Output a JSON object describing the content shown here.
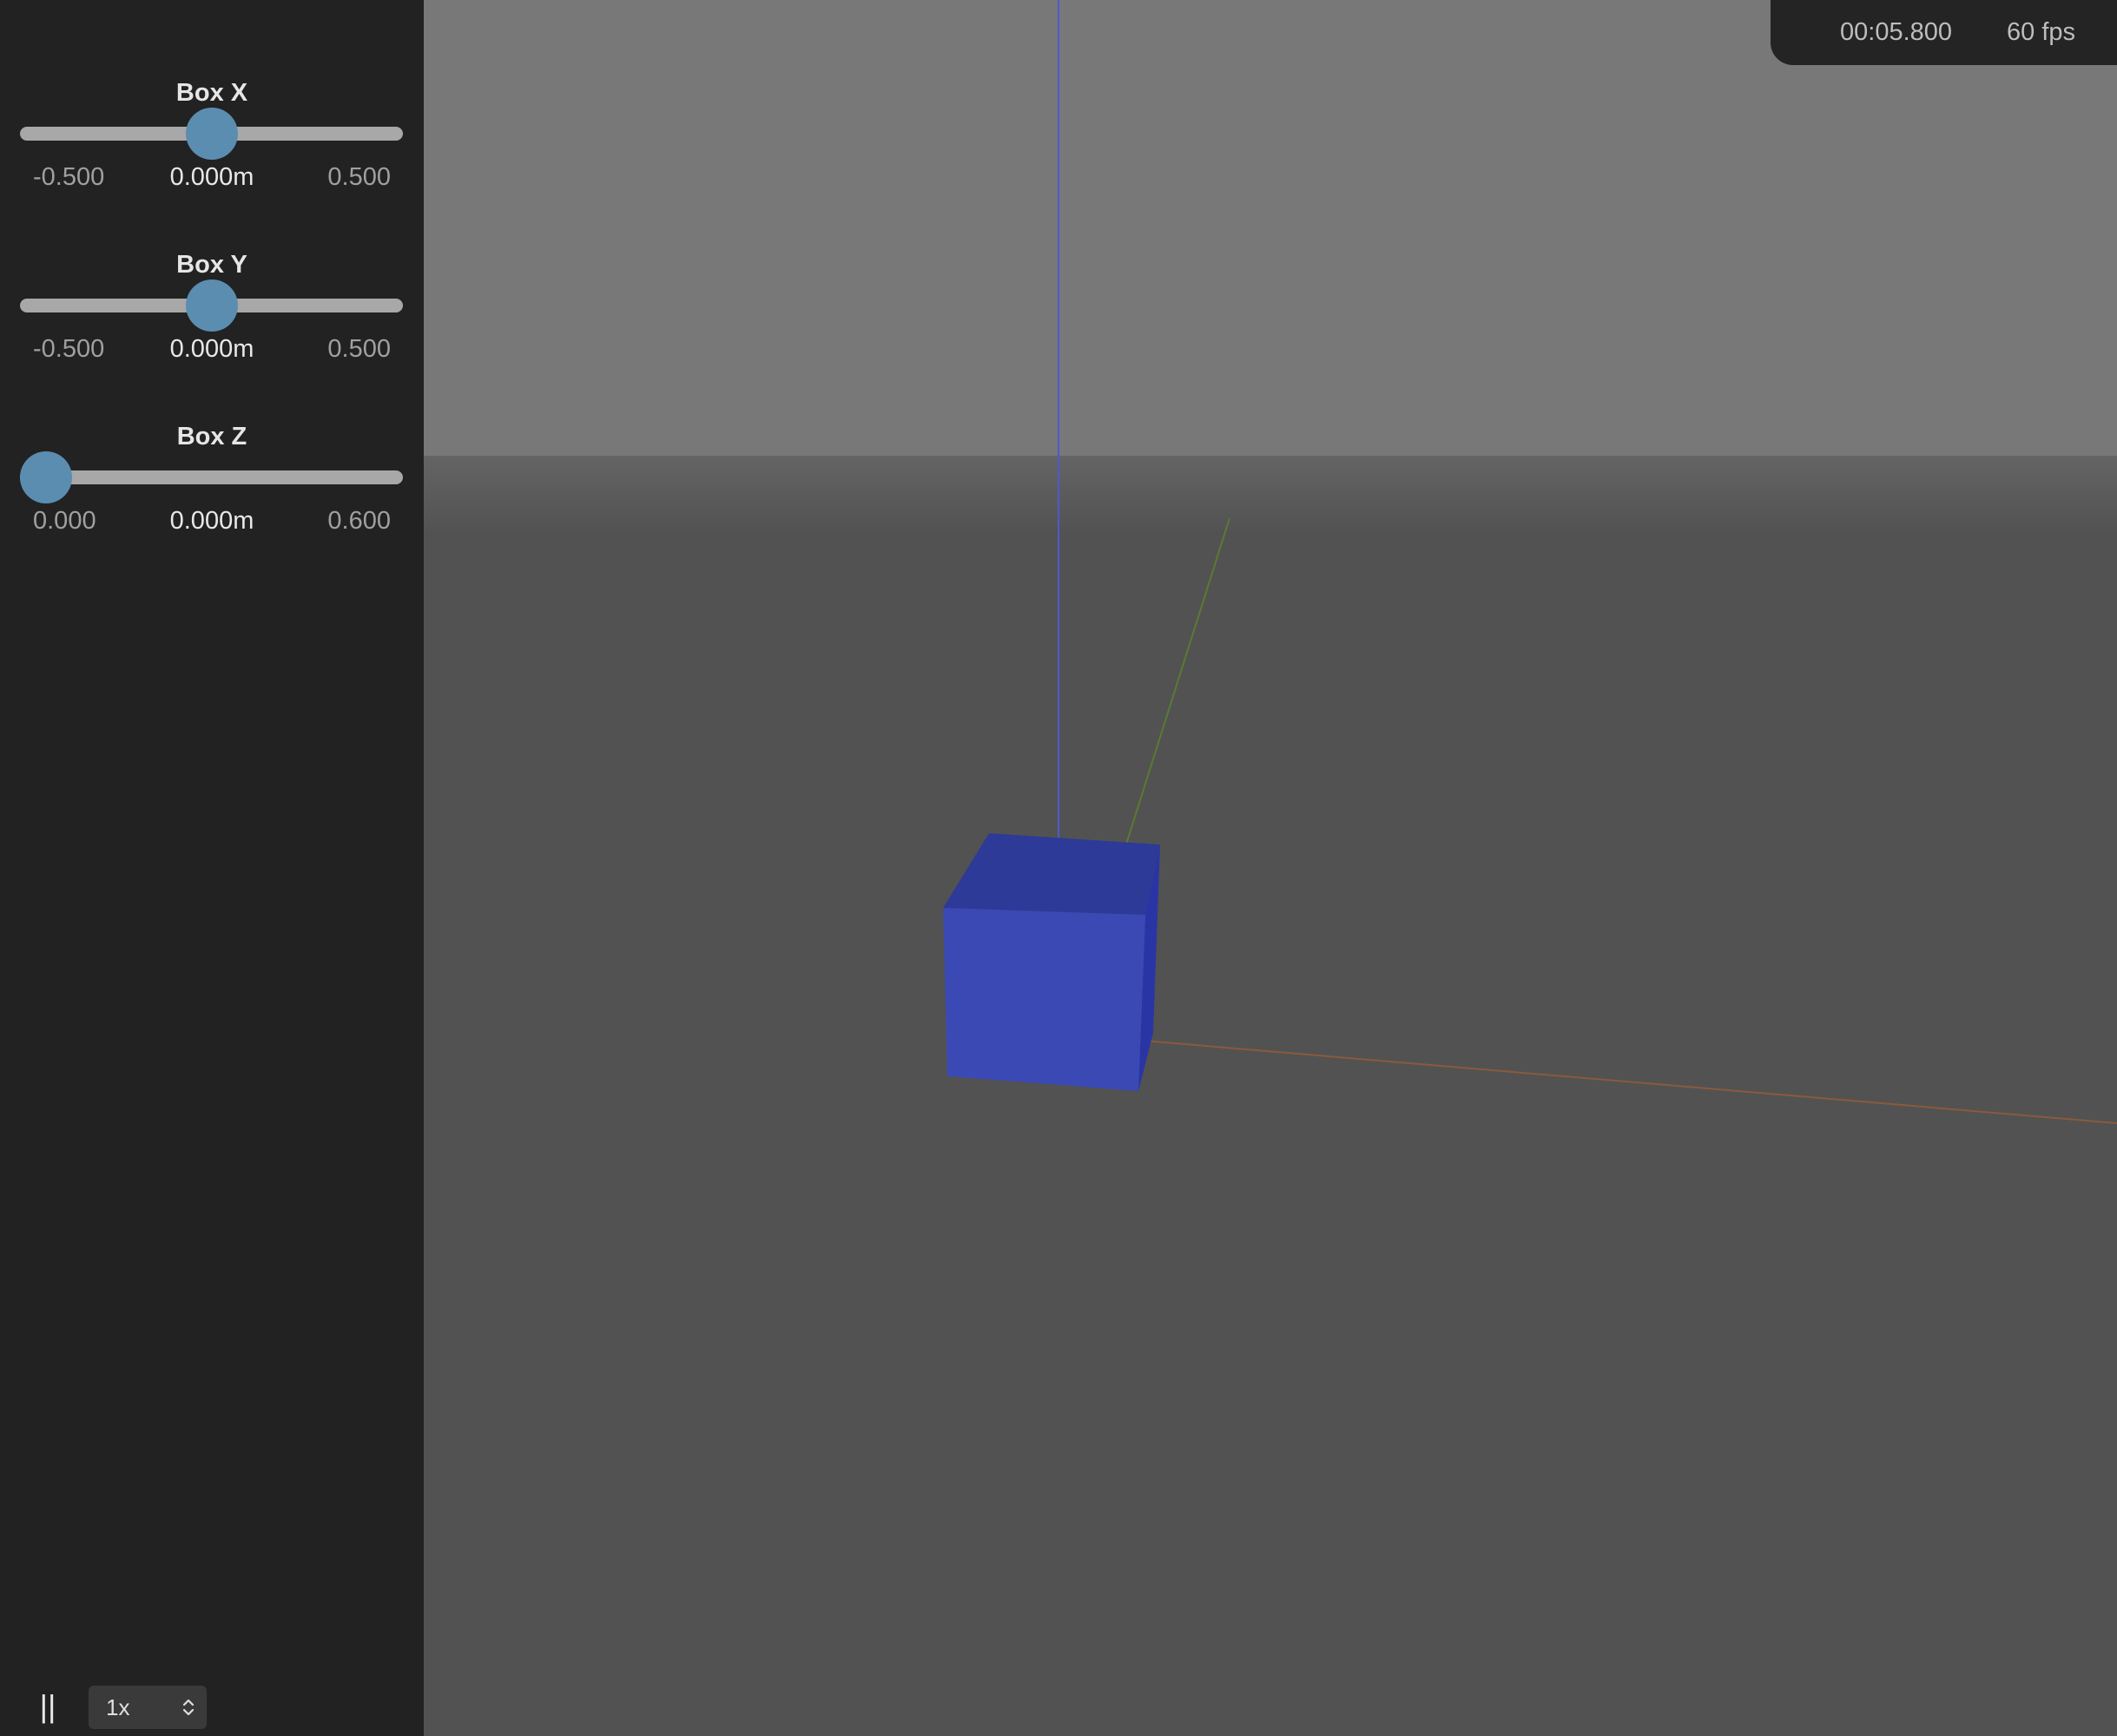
{
  "controls": [
    {
      "label": "Box X",
      "min_label": "-0.500",
      "max_label": "0.500",
      "value_label": "0.000m",
      "min": -0.5,
      "max": 0.5,
      "value": 0.0
    },
    {
      "label": "Box Y",
      "min_label": "-0.500",
      "max_label": "0.500",
      "value_label": "0.000m",
      "min": -0.5,
      "max": 0.5,
      "value": 0.0
    },
    {
      "label": "Box Z",
      "min_label": "0.000",
      "max_label": "0.600",
      "value_label": "0.000m",
      "min": 0.0,
      "max": 0.6,
      "value": 0.0
    }
  ],
  "playback": {
    "pause_label": "||",
    "speed": "1x"
  },
  "hud": {
    "time": "00:05.800",
    "fps": "60 fps"
  },
  "colors": {
    "panel_bg": "#222222",
    "slider_track": "#a8a8a8",
    "slider_thumb": "#5b8db0",
    "sky": "#787878",
    "ground": "#525252",
    "box_front": "#3b49b5",
    "box_top": "#2d3a97",
    "box_side": "#2a35a5",
    "axis_x": "#8a5a3c",
    "axis_y": "#5a7a32",
    "axis_z": "#4a5ad0"
  },
  "scene": {
    "objects": [
      "box",
      "x-axis",
      "y-axis",
      "z-axis",
      "ground",
      "sky"
    ]
  }
}
